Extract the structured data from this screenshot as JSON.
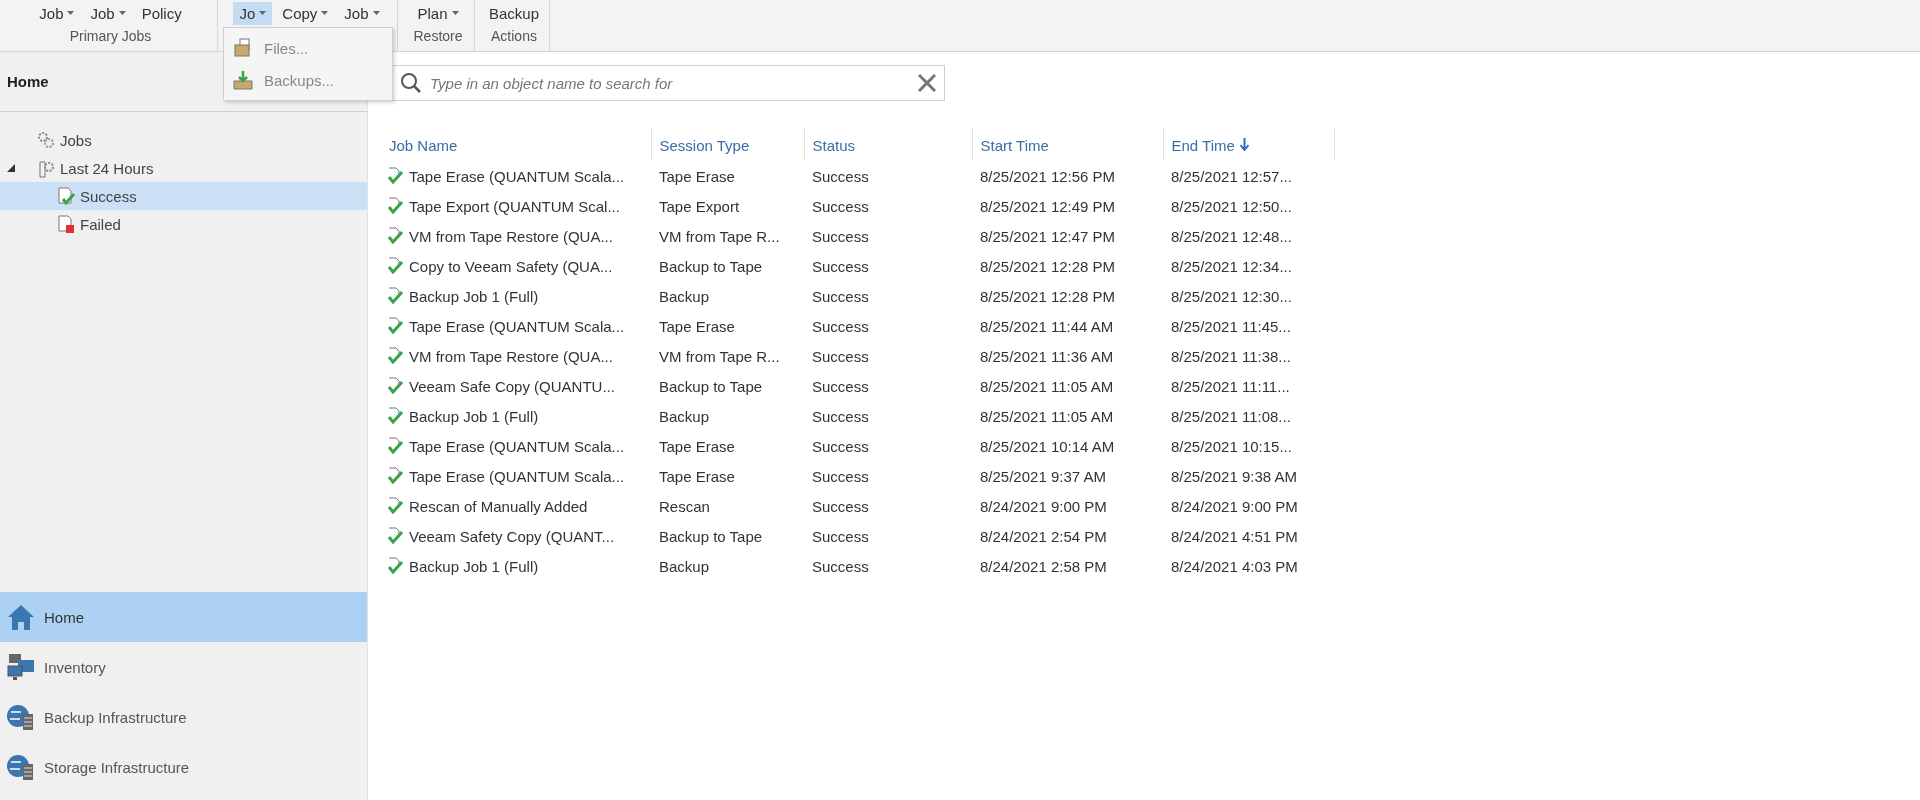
{
  "ribbon": {
    "groups": [
      {
        "label": "Primary Jobs",
        "buttons": [
          {
            "label": "Job",
            "dropdown": true,
            "selected": false
          },
          {
            "label": "Job",
            "dropdown": true,
            "selected": false
          },
          {
            "label": "Policy",
            "dropdown": false,
            "selected": false
          }
        ]
      },
      {
        "buttons": [
          {
            "label": "Jo",
            "dropdown": true,
            "selected": true
          },
          {
            "label": "Copy",
            "dropdown": true,
            "selected": false
          },
          {
            "label": "Job",
            "dropdown": true,
            "selected": false
          }
        ]
      },
      {
        "label": "Restore",
        "buttons": [
          {
            "label": "Plan",
            "dropdown": true,
            "selected": false
          }
        ]
      },
      {
        "label": "Actions",
        "buttons": [
          {
            "label": "Backup",
            "dropdown": false,
            "selected": false
          }
        ]
      }
    ]
  },
  "dropdown_menu": {
    "items": [
      {
        "label": "Files..."
      },
      {
        "label": "Backups..."
      }
    ]
  },
  "sidebar": {
    "title": "Home",
    "tree": [
      {
        "label": "Jobs",
        "kind": "jobs",
        "selected": false
      },
      {
        "label": "Last 24 Hours",
        "kind": "history",
        "selected": false,
        "expanded": true,
        "children": [
          {
            "label": "Success",
            "kind": "success",
            "selected": true
          },
          {
            "label": "Failed",
            "kind": "failed",
            "selected": false
          }
        ]
      }
    ],
    "nav": [
      {
        "label": "Home",
        "selected": true
      },
      {
        "label": "Inventory",
        "selected": false
      },
      {
        "label": "Backup Infrastructure",
        "selected": false
      },
      {
        "label": "Storage Infrastructure",
        "selected": false
      }
    ]
  },
  "search": {
    "placeholder": "Type in an object name to search for"
  },
  "table": {
    "columns": [
      {
        "label": "Job Name"
      },
      {
        "label": "Session Type"
      },
      {
        "label": "Status"
      },
      {
        "label": "Start Time"
      },
      {
        "label": "End Time",
        "sorted_descending": true
      }
    ],
    "rows": [
      [
        "Tape Erase (QUANTUM Scala...",
        "Tape Erase",
        "Success",
        "8/25/2021 12:56 PM",
        "8/25/2021 12:57..."
      ],
      [
        "Tape Export (QUANTUM Scal...",
        "Tape Export",
        "Success",
        "8/25/2021 12:49 PM",
        "8/25/2021 12:50..."
      ],
      [
        "VM from Tape Restore (QUA...",
        "VM from Tape R...",
        "Success",
        "8/25/2021 12:47 PM",
        "8/25/2021 12:48..."
      ],
      [
        "Copy to Veeam Safety (QUA...",
        "Backup to Tape",
        "Success",
        "8/25/2021 12:28 PM",
        "8/25/2021 12:34..."
      ],
      [
        "Backup Job 1 (Full)",
        "Backup",
        "Success",
        "8/25/2021 12:28 PM",
        "8/25/2021 12:30..."
      ],
      [
        "Tape Erase (QUANTUM Scala...",
        "Tape Erase",
        "Success",
        "8/25/2021 11:44 AM",
        "8/25/2021 11:45..."
      ],
      [
        "VM from Tape Restore (QUA...",
        "VM from Tape R...",
        "Success",
        "8/25/2021 11:36 AM",
        "8/25/2021 11:38..."
      ],
      [
        "Veeam Safe Copy (QUANTU...",
        "Backup to Tape",
        "Success",
        "8/25/2021 11:05 AM",
        "8/25/2021 11:11..."
      ],
      [
        "Backup Job 1 (Full)",
        "Backup",
        "Success",
        "8/25/2021 11:05 AM",
        "8/25/2021 11:08..."
      ],
      [
        "Tape Erase (QUANTUM Scala...",
        "Tape Erase",
        "Success",
        "8/25/2021 10:14 AM",
        "8/25/2021 10:15..."
      ],
      [
        "Tape Erase (QUANTUM Scala...",
        "Tape Erase",
        "Success",
        "8/25/2021 9:37 AM",
        "8/25/2021 9:38 AM"
      ],
      [
        "Rescan of Manually Added",
        "Rescan",
        "Success",
        "8/24/2021 9:00 PM",
        "8/24/2021 9:00 PM"
      ],
      [
        "Veeam Safety Copy (QUANT...",
        "Backup to Tape",
        "Success",
        "8/24/2021 2:54 PM",
        "8/24/2021 4:51 PM"
      ],
      [
        "Backup Job 1 (Full)",
        "Backup",
        "Success",
        "8/24/2021 2:58 PM",
        "8/24/2021 4:03 PM"
      ]
    ]
  }
}
